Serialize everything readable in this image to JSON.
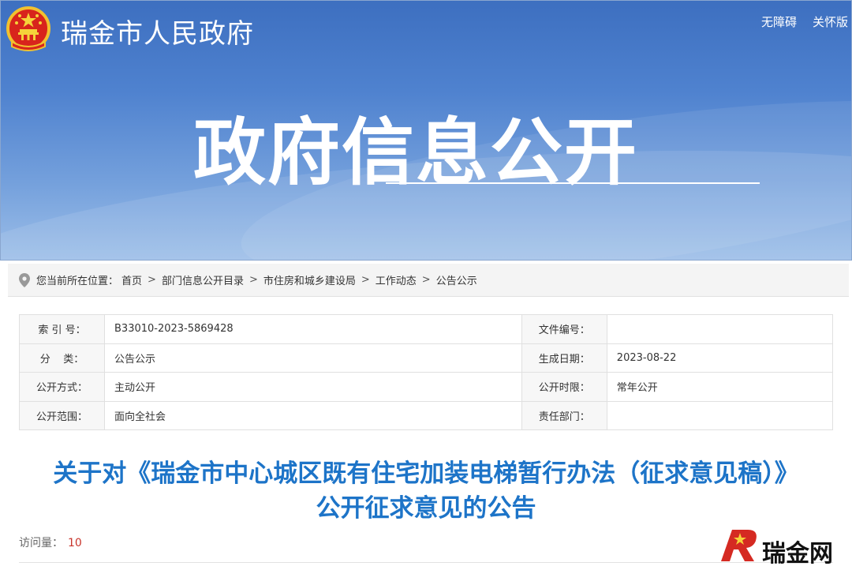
{
  "header": {
    "site_name": "瑞金市人民政府",
    "links": [
      "无障碍",
      "关怀版"
    ],
    "banner_title": "政府信息公开",
    "colors": {
      "banner": "#4f82cf",
      "title": "#1d74c8"
    }
  },
  "breadcrumb": {
    "prefix": "您当前所在位置：",
    "items": [
      "首页",
      "部门信息公开目录",
      "市住房和城乡建设局",
      "工作动态",
      "公告公示"
    ]
  },
  "meta": {
    "rows": [
      {
        "l1": "索 引 号：",
        "v1": "B33010-2023-5869428",
        "l2": "文件编号：",
        "v2": ""
      },
      {
        "l1": "分    类：",
        "v1": "公告公示",
        "l2": "生成日期：",
        "v2": "2023-08-22"
      },
      {
        "l1": "公开方式：",
        "v1": "主动公开",
        "l2": "公开时限：",
        "v2": "常年公开"
      },
      {
        "l1": "公开范围：",
        "v1": "面向全社会",
        "l2": "责任部门：",
        "v2": ""
      }
    ]
  },
  "article": {
    "title_line1": "关于对《瑞金市中心城区既有住宅加装电梯暂行办法（征求意见稿）》",
    "title_line2": "公开征求意见的公告",
    "visits_label": "访问量：",
    "visits_value": "10"
  },
  "watermark": {
    "text": "瑞金网"
  }
}
